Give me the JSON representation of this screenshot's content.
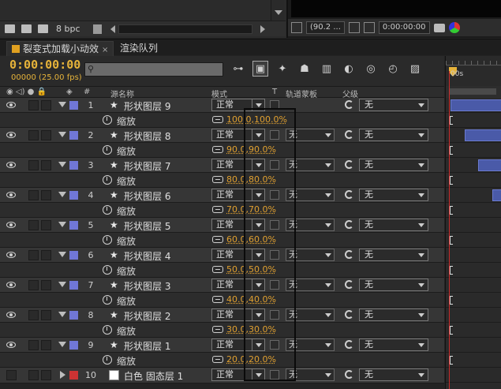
{
  "project": {
    "bpc_label": "8 bpc"
  },
  "viewer": {
    "zoom_label": "(90.2 ...",
    "timecode": "0:00:00:00"
  },
  "tabs": [
    {
      "label": "裂变式加载小动效",
      "active": true
    },
    {
      "label": "渲染队列",
      "active": false
    }
  ],
  "timeline": {
    "timecode": "0:00:00:00",
    "frame_info": "00000 (25.00 fps)",
    "search_placeholder": "",
    "ruler_label": "00s"
  },
  "columns": {
    "hash": "#",
    "source_name": "源名称",
    "mode": "模式",
    "t": "T",
    "track_matte": "轨道蒙板",
    "parent": "父级"
  },
  "layers": [
    {
      "num": "1",
      "name": "形状图层 9",
      "mode": "正常",
      "matte": "",
      "parent": "无",
      "prop": "缩放",
      "scale": "100.0,100.0%"
    },
    {
      "num": "2",
      "name": "形状图层 8",
      "mode": "正常",
      "matte": "无",
      "parent": "无",
      "prop": "缩放",
      "scale": "90.0,90.0%"
    },
    {
      "num": "3",
      "name": "形状图层 7",
      "mode": "正常",
      "matte": "无",
      "parent": "无",
      "prop": "缩放",
      "scale": "80.0,80.0%"
    },
    {
      "num": "4",
      "name": "形状图层 6",
      "mode": "正常",
      "matte": "无",
      "parent": "无",
      "prop": "缩放",
      "scale": "70.0,70.0%"
    },
    {
      "num": "5",
      "name": "形状图层 5",
      "mode": "正常",
      "matte": "无",
      "parent": "无",
      "prop": "缩放",
      "scale": "60.0,60.0%"
    },
    {
      "num": "6",
      "name": "形状图层 4",
      "mode": "正常",
      "matte": "无",
      "parent": "无",
      "prop": "缩放",
      "scale": "50.0,50.0%"
    },
    {
      "num": "7",
      "name": "形状图层 3",
      "mode": "正常",
      "matte": "无",
      "parent": "无",
      "prop": "缩放",
      "scale": "40.0,40.0%"
    },
    {
      "num": "8",
      "name": "形状图层 2",
      "mode": "正常",
      "matte": "无",
      "parent": "无",
      "prop": "缩放",
      "scale": "30.0,30.0%"
    },
    {
      "num": "9",
      "name": "形状图层 1",
      "mode": "正常",
      "matte": "无",
      "parent": "无",
      "prop": "缩放",
      "scale": "20.0,20.0%"
    }
  ],
  "solid_layer": {
    "num": "10",
    "name": "白色 固态层 1",
    "mode": "正常",
    "matte": "无",
    "parent": "无"
  },
  "colors": {
    "accent": "#e6b33a",
    "label_shape": "#7077d6",
    "label_solid": "#cc3333",
    "bar": "#4a5aa8"
  }
}
